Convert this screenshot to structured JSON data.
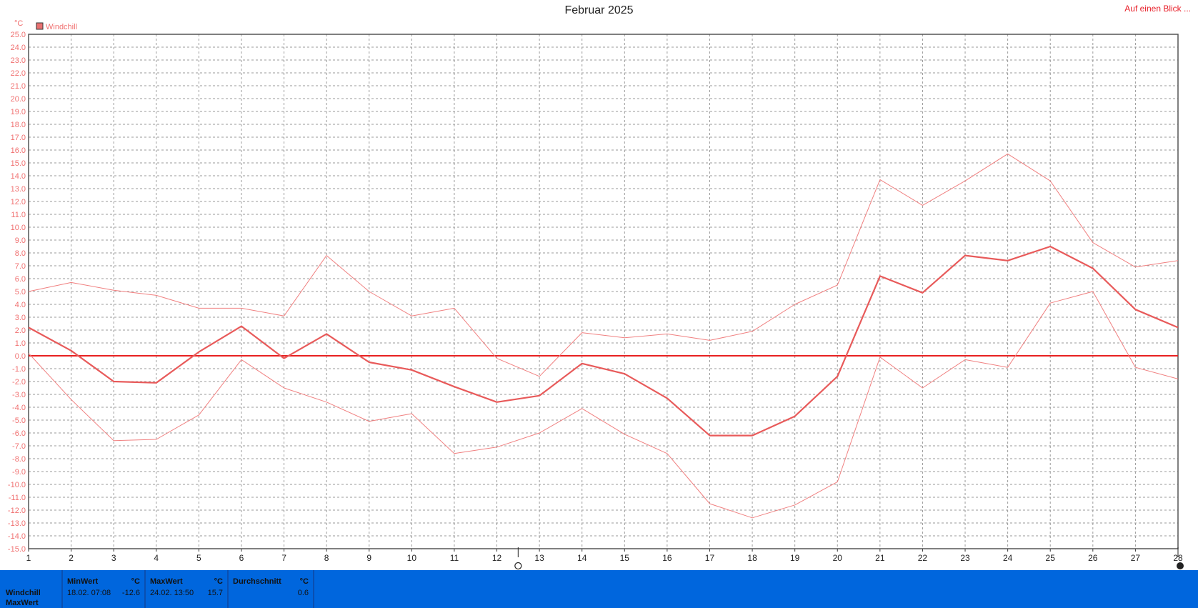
{
  "chart_title": "Februar 2025",
  "overview_link": "Auf einen Blick ...",
  "chart_data": {
    "type": "line",
    "title": "Februar 2025",
    "ylabel": "°C",
    "xlabel": "",
    "legend": {
      "entries": [
        "Windchill"
      ],
      "placement": "top-left",
      "color": "#e87070"
    },
    "ylim": [
      -15,
      25
    ],
    "y_step": 1,
    "x": [
      1,
      2,
      3,
      4,
      5,
      6,
      7,
      8,
      9,
      10,
      11,
      12,
      13,
      14,
      15,
      16,
      17,
      18,
      19,
      20,
      21,
      22,
      23,
      24,
      25,
      26,
      27,
      28
    ],
    "grid": true,
    "zero_line": {
      "value": 0,
      "color": "#e82020"
    },
    "series": [
      {
        "role": "max",
        "color": "#f08080",
        "values": [
          5.0,
          5.7,
          5.1,
          4.7,
          3.7,
          3.7,
          3.1,
          7.8,
          5.0,
          3.1,
          3.7,
          -0.2,
          -1.6,
          1.8,
          1.4,
          1.7,
          1.2,
          1.9,
          4.0,
          5.5,
          13.7,
          11.7,
          13.6,
          15.7,
          13.6,
          8.8,
          6.9,
          7.4
        ]
      },
      {
        "name": "Windchill",
        "role": "avg",
        "color": "#e85a5a",
        "values": [
          2.2,
          0.4,
          -2.0,
          -2.1,
          0.3,
          2.3,
          -0.2,
          1.7,
          -0.5,
          -1.1,
          -2.4,
          -3.6,
          -3.1,
          -0.6,
          -1.4,
          -3.3,
          -6.2,
          -6.2,
          -4.7,
          -1.6,
          6.2,
          4.9,
          7.8,
          7.4,
          8.5,
          6.8,
          3.6,
          2.2
        ]
      },
      {
        "role": "min",
        "color": "#f08080",
        "values": [
          0.2,
          -3.4,
          -6.6,
          -6.5,
          -4.6,
          -0.3,
          -2.5,
          -3.6,
          -5.1,
          -4.5,
          -7.6,
          -7.1,
          -6.0,
          -4.1,
          -6.1,
          -7.6,
          -11.5,
          -12.6,
          -11.6,
          -9.8,
          -0.1,
          -2.5,
          -0.3,
          -0.9,
          4.1,
          5.0,
          -0.9,
          -1.8
        ]
      }
    ]
  },
  "footer": {
    "row_labels": [
      "Windchill",
      "MaxWert"
    ],
    "cells": [
      {
        "header": "MinWert",
        "unit": "°C",
        "when": "18.02.  07:08",
        "value": "-12.6"
      },
      {
        "header": "MaxWert",
        "unit": "°C",
        "when": "24.02.  13:50",
        "value": "15.7"
      },
      {
        "header": "Durchschnitt",
        "unit": "°C",
        "when": "",
        "value": "0.6"
      }
    ]
  }
}
